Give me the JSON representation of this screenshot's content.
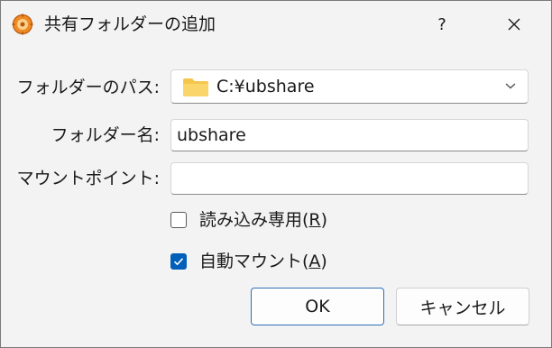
{
  "window": {
    "title": "共有フォルダーの追加",
    "help_label": "?",
    "close_label": "✕"
  },
  "form": {
    "folder_path_label": "フォルダーのパス:",
    "folder_path_value": "C:¥ubshare",
    "folder_name_label": "フォルダー名:",
    "folder_name_value": "ubshare",
    "mount_point_label": "マウントポイント:",
    "mount_point_value": ""
  },
  "options": {
    "readonly": {
      "text": "読み込み専用(",
      "key": "R",
      "suffix": ")",
      "checked": false
    },
    "automount": {
      "text": "自動マウント(",
      "key": "A",
      "suffix": ")",
      "checked": true
    }
  },
  "buttons": {
    "ok_label": "OK",
    "cancel_label": "キャンセル"
  },
  "colors": {
    "accent": "#005fb8",
    "folder_icon": "#f4c64e",
    "app_icon": "#f08a24"
  },
  "icons": {
    "app": "virtualbox-gear-icon",
    "folder": "folder-icon",
    "dropdown": "chevron-down-icon",
    "check": "checkmark-icon"
  }
}
